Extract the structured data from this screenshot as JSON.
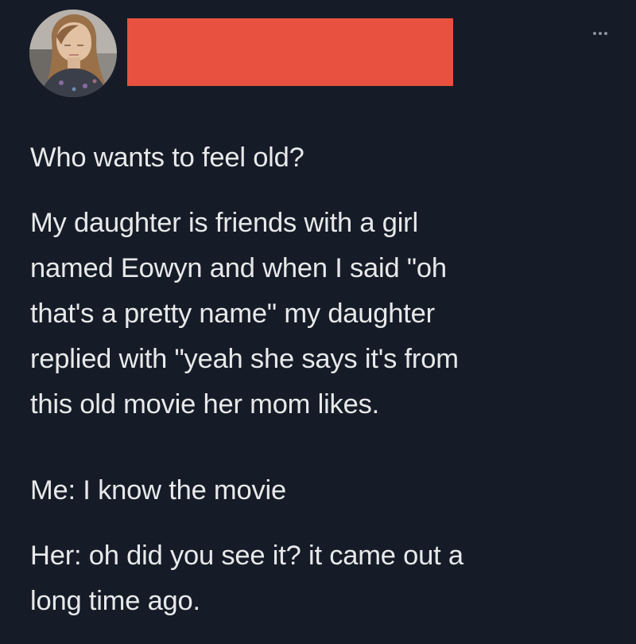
{
  "tweet": {
    "more_icon": "more-horizontal-icon",
    "paragraphs": [
      "Who wants to feel old?",
      "My daughter is friends with a girl\nnamed Eowyn and when I said \"oh\nthat's a pretty name\" my daughter\nreplied with \"yeah she says it's from\nthis old movie her mom likes.",
      "Me: I know the movie",
      "Her: oh did you see it? it came out a\nlong time ago."
    ]
  },
  "colors": {
    "background": "#161c27",
    "text": "#e7e9ea",
    "redaction": "#e8513f",
    "icon": "#8a929c"
  }
}
